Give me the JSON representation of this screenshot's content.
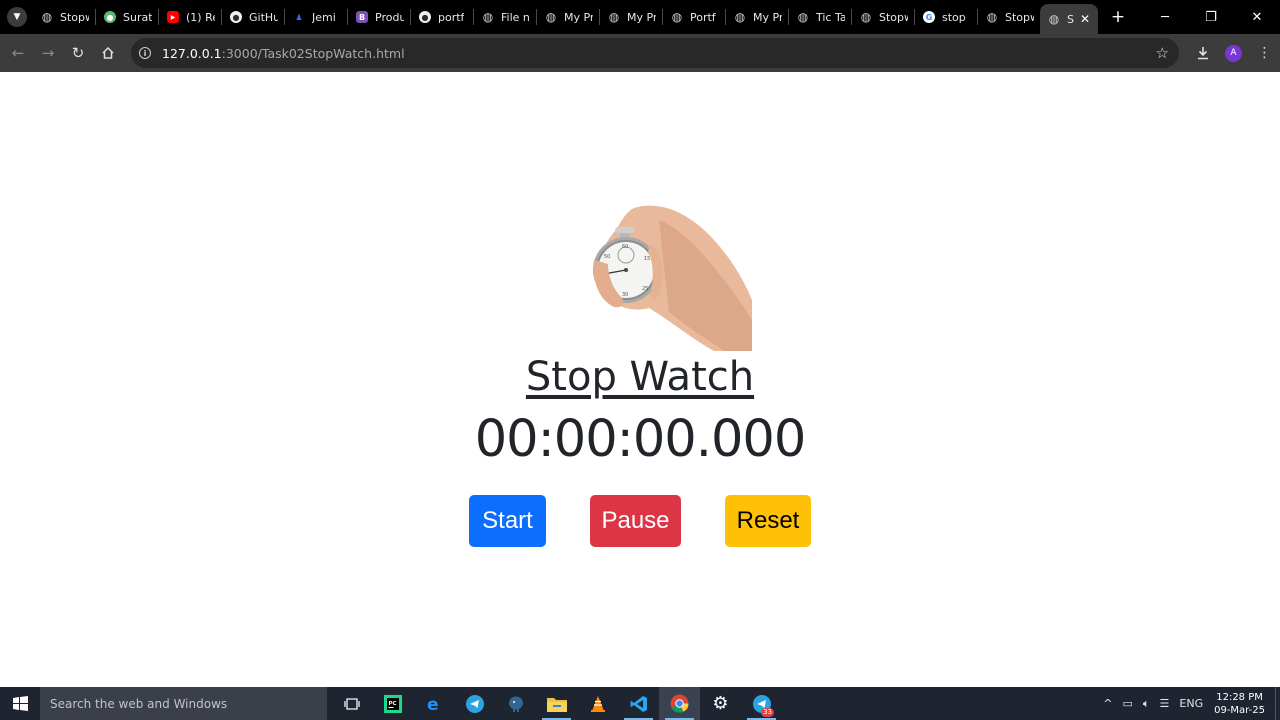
{
  "browser": {
    "tabs": [
      {
        "label": "Stopw",
        "icon": "globe-icon",
        "color": "#9aa0a6"
      },
      {
        "label": "Surat",
        "icon": "profile-icon",
        "color": "#5bb974"
      },
      {
        "label": "(1) Re",
        "icon": "youtube-icon",
        "color": "#ff0000"
      },
      {
        "label": "GitHu",
        "icon": "github-icon",
        "color": "#2b2b2b"
      },
      {
        "label": "Jemi",
        "icon": "person-icon",
        "color": "#3a6ee8"
      },
      {
        "label": "Produ",
        "icon": "bootstrap-icon",
        "color": "#7952b3"
      },
      {
        "label": "portf",
        "icon": "github-icon",
        "color": "#2b2b2b"
      },
      {
        "label": "File n",
        "icon": "globe-icon",
        "color": "#9aa0a6"
      },
      {
        "label": "My Pr",
        "icon": "globe-icon",
        "color": "#9aa0a6"
      },
      {
        "label": "My Pr",
        "icon": "globe-icon",
        "color": "#9aa0a6"
      },
      {
        "label": "Portf",
        "icon": "globe-icon",
        "color": "#9aa0a6"
      },
      {
        "label": "My Pr",
        "icon": "globe-icon",
        "color": "#9aa0a6"
      },
      {
        "label": "Tic Ta",
        "icon": "globe-icon",
        "color": "#9aa0a6"
      },
      {
        "label": "Stopw",
        "icon": "globe-icon",
        "color": "#9aa0a6"
      },
      {
        "label": "stop",
        "icon": "google-icon",
        "color": "#ffffff"
      },
      {
        "label": "Stopw",
        "icon": "globe-icon",
        "color": "#9aa0a6"
      },
      {
        "label": "S",
        "icon": "globe-icon",
        "color": "#9aa0a6",
        "active": true
      }
    ],
    "url_host": "127.0.0.1",
    "url_path": ":3000/Task02StopWatch.html",
    "profile_initial": "A"
  },
  "page": {
    "title": "Stop Watch",
    "time": "00:00:00.000",
    "buttons": {
      "start": "Start",
      "pause": "Pause",
      "reset": "Reset"
    },
    "colors": {
      "start": "#0d6efd",
      "pause": "#dc3545",
      "reset": "#ffc107"
    }
  },
  "taskbar": {
    "search_placeholder": "Search the web and Windows",
    "language": "ENG",
    "time": "12:28 PM",
    "date": "09-Mar-25",
    "telegram_badge": "33"
  }
}
